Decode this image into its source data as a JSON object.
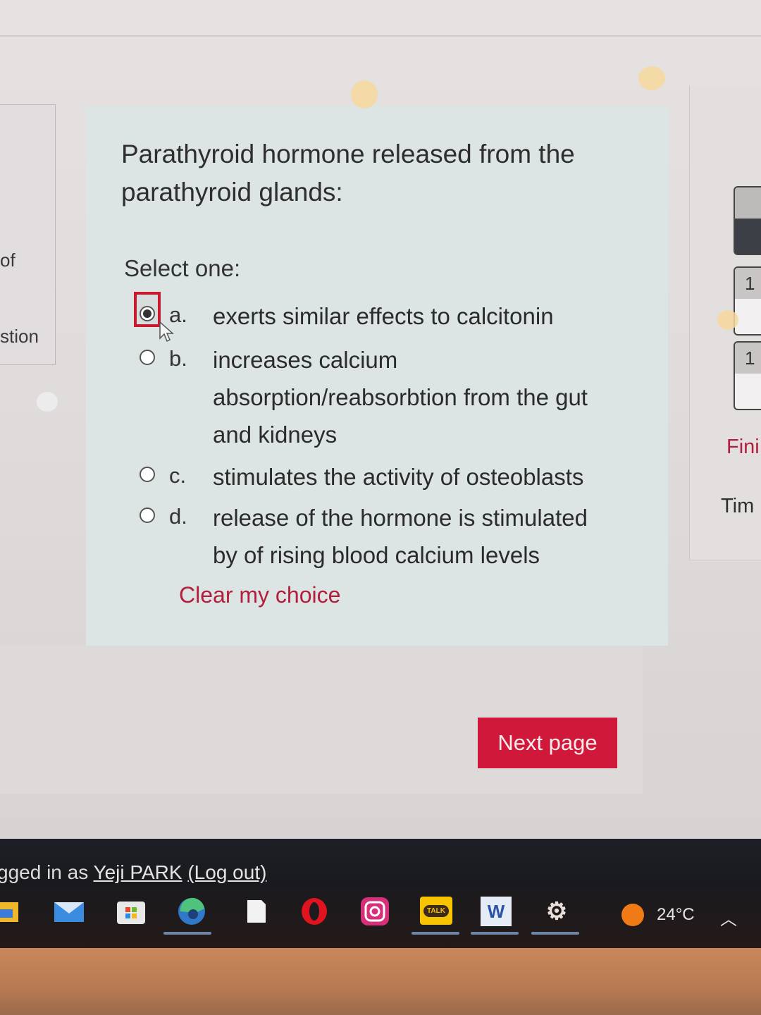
{
  "sidebar_left": {
    "fragment_1": "of",
    "fragment_2": "stion"
  },
  "question": {
    "text": "Parathyroid hormone released from the parathyroid glands:",
    "prompt": "Select one:",
    "answers": [
      {
        "letter": "a.",
        "text": "exerts similar effects to calcitonin",
        "selected": true
      },
      {
        "letter": "b.",
        "text": "increases calcium absorption/reabsorbtion from the gut and kidneys",
        "selected": false
      },
      {
        "letter": "c.",
        "text": "stimulates the activity of osteoblasts",
        "selected": false
      },
      {
        "letter": "d.",
        "text": "release of the hormone is stimulated by of rising blood calcium levels",
        "selected": false
      }
    ],
    "clear_label": "Clear my choice"
  },
  "navigation": {
    "next_label": "Next page",
    "quiz_nav_numbers": [
      "",
      "1",
      "1"
    ],
    "finish_label": "Fini",
    "timer_label": "Tim"
  },
  "footer": {
    "logged_in_prefix": "gged in as ",
    "user_name": "Yeji PARK",
    "logout_label": "(Log out)"
  },
  "taskbar": {
    "apps": [
      "file-explorer",
      "mail",
      "microsoft-store",
      "edge",
      "notepad",
      "opera",
      "instagram",
      "kakaotalk",
      "word",
      "settings"
    ],
    "kakao_label": "TALK",
    "word_label": "W",
    "temperature": "24°C"
  },
  "colors": {
    "accent": "#d0193a",
    "link": "#b31e3d",
    "card": "#dde4e4"
  }
}
